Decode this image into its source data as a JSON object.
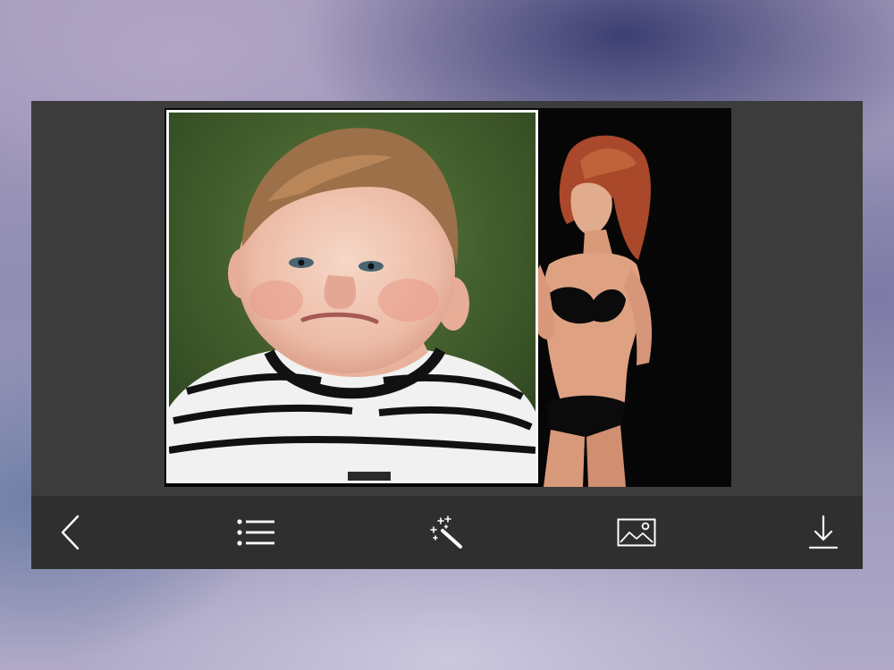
{
  "toolbar": {
    "items": [
      {
        "icon": "chevron-left-icon",
        "action": "back"
      },
      {
        "icon": "list-icon",
        "action": "frames"
      },
      {
        "icon": "magic-wand-icon",
        "action": "effects"
      },
      {
        "icon": "image-icon",
        "action": "gallery"
      },
      {
        "icon": "download-icon",
        "action": "save"
      }
    ],
    "icon_color": "#ffffff",
    "background": "#2f2f2f"
  },
  "canvas": {
    "background": "#3c3c3c",
    "photo_border_color": "#f4f4f4"
  }
}
